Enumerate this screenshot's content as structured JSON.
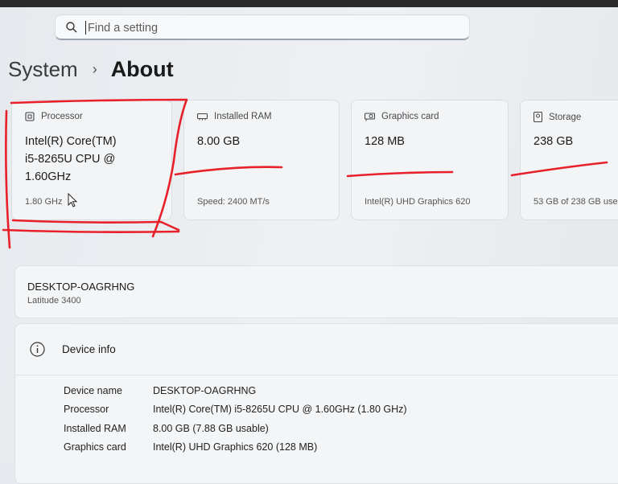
{
  "search": {
    "placeholder": "Find a setting"
  },
  "breadcrumb": {
    "parent": "System",
    "current": "About"
  },
  "cards": {
    "processor": {
      "title": "Processor",
      "line1": "Intel(R) Core(TM)",
      "line2": "i5-8265U CPU @",
      "line3": "1.60GHz",
      "sub": "1.80 GHz"
    },
    "ram": {
      "title": "Installed RAM",
      "value": "8.00 GB",
      "sub": "Speed: 2400 MT/s"
    },
    "graphics": {
      "title": "Graphics card",
      "value": "128 MB",
      "sub": "Intel(R) UHD Graphics 620"
    },
    "storage": {
      "title": "Storage",
      "value": "238 GB",
      "sub": "53 GB of 238 GB use"
    }
  },
  "device": {
    "name": "DESKTOP-OAGRHNG",
    "model": "Latitude 3400"
  },
  "device_info": {
    "title": "Device info",
    "rows": [
      {
        "label": "Device name",
        "value": "DESKTOP-OAGRHNG"
      },
      {
        "label": "Processor",
        "value": "Intel(R) Core(TM) i5-8265U CPU @ 1.60GHz (1.80 GHz)"
      },
      {
        "label": "Installed RAM",
        "value": "8.00 GB (7.88 GB usable)"
      },
      {
        "label": "Graphics card",
        "value": "Intel(R) UHD Graphics 620 (128 MB)"
      }
    ]
  },
  "colors": {
    "annotation": "#e8202a",
    "accent_underline": "#9aa3ad"
  }
}
